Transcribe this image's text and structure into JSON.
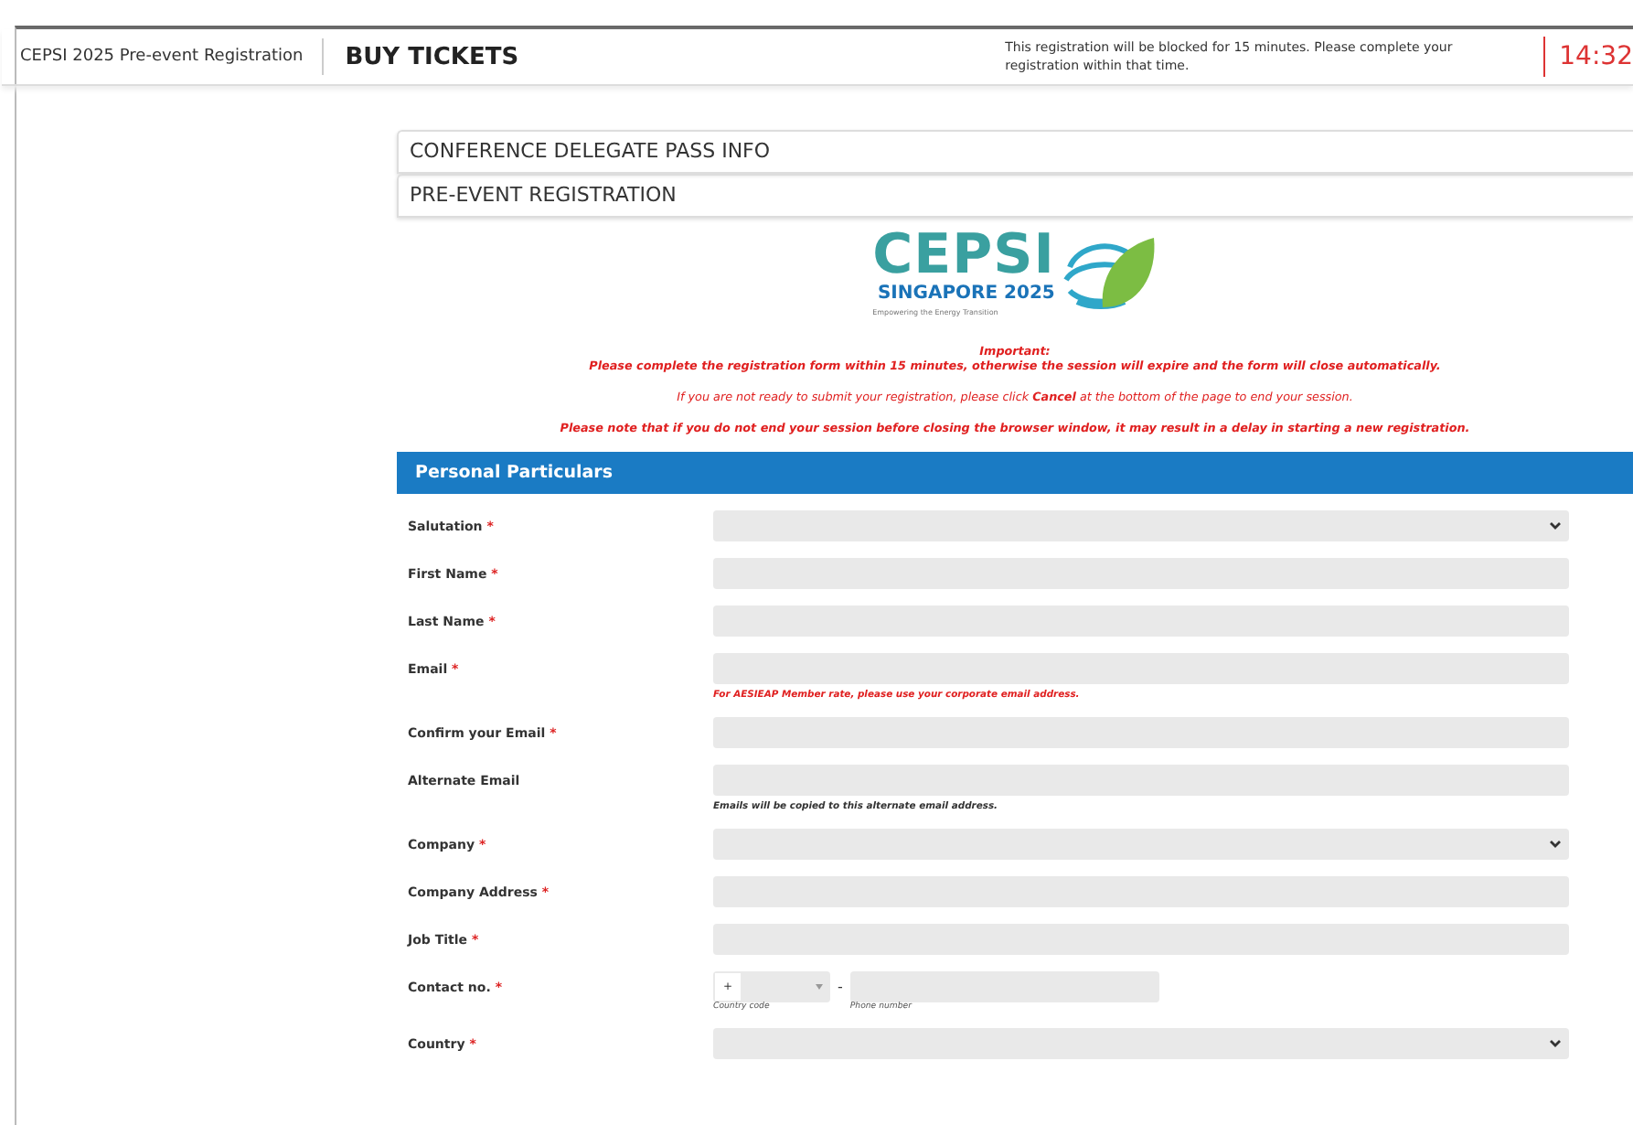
{
  "header": {
    "event_name": "CEPSI 2025 Pre-event Registration",
    "title": "BUY TICKETS",
    "notice": "This registration will be blocked for 15 minutes. Please complete your registration within that time.",
    "timer": "14:32"
  },
  "sections": [
    {
      "label": "CONFERENCE DELEGATE PASS INFO"
    },
    {
      "label": "PRE-EVENT REGISTRATION"
    }
  ],
  "logo": {
    "title": "CEPSI",
    "subtitle": "SINGAPORE 2025",
    "tagline": "Empowering the Energy Transition"
  },
  "notices": [
    {
      "kind": "heading",
      "text": "Important:"
    },
    {
      "kind": "strong",
      "text": "Please complete the registration form within 15 minutes, otherwise the session will expire and the form will close automatically."
    },
    {
      "kind": "plain",
      "text": "If you are not ready to submit your registration, please click **Cancel** at the bottom of the page to end your session."
    },
    {
      "kind": "strong",
      "text": "Please note that if you do not end your session before closing the browser window, it may result in a delay in starting a new registration."
    }
  ],
  "form": {
    "heading": "Personal Particulars",
    "fields": [
      {
        "label": "Salutation",
        "required_mark": "*",
        "kind": "select"
      },
      {
        "label": "First Name",
        "required_mark": "*",
        "kind": "text"
      },
      {
        "label": "Last Name",
        "required_mark": "*",
        "kind": "text"
      },
      {
        "label": "Email",
        "required_mark": "*",
        "kind": "text",
        "note": {
          "kind": "warning",
          "text": "For AESIEAP Member rate, please use your corporate email address."
        }
      },
      {
        "label": "Confirm your Email",
        "required_mark": "*",
        "kind": "text"
      },
      {
        "label": "Alternate Email",
        "kind": "text",
        "note": {
          "kind": "info",
          "text": "Emails will be copied to this alternate email address."
        }
      },
      {
        "label": "Company",
        "required_mark": "*",
        "kind": "select"
      },
      {
        "label": "Company Address",
        "required_mark": "*",
        "kind": "text"
      },
      {
        "label": "Job Title",
        "required_mark": "*",
        "kind": "text"
      },
      {
        "label": "Contact no.",
        "required_mark": "*",
        "kind": "phone",
        "prefix": "+",
        "separator": "-",
        "code_caption": "Country code",
        "number_caption": "Phone number"
      },
      {
        "label": "Country",
        "required_mark": "*",
        "kind": "select"
      }
    ]
  }
}
